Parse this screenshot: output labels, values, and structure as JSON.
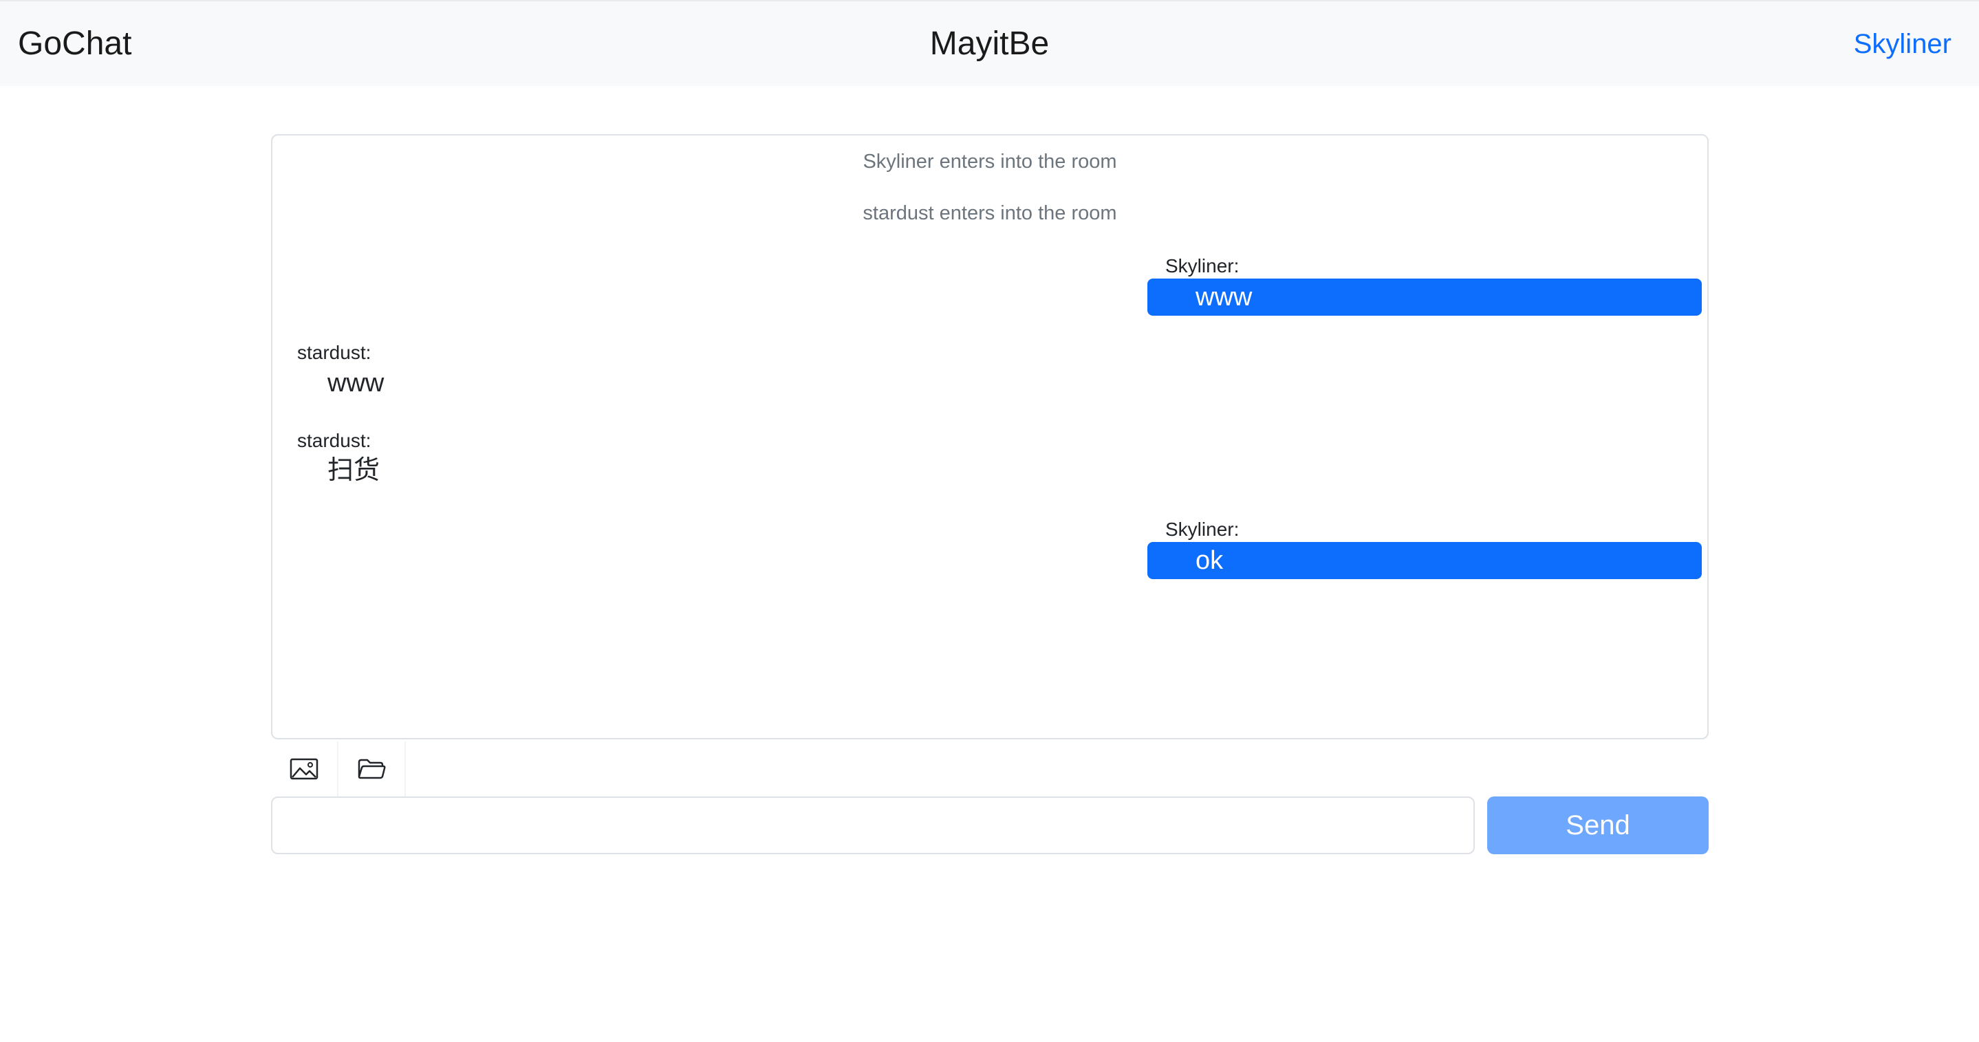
{
  "navbar": {
    "brand": "GoChat",
    "room_name": "MayitBe",
    "current_user": "Skyliner"
  },
  "messages": [
    {
      "type": "system",
      "text": "Skyliner enters into the room"
    },
    {
      "type": "system",
      "text": "stardust enters into the room"
    },
    {
      "type": "self",
      "sender": "Skyliner:",
      "text": "www"
    },
    {
      "type": "other",
      "sender": "stardust:",
      "text": "www"
    },
    {
      "type": "other",
      "sender": "stardust:",
      "text": "扫货"
    },
    {
      "type": "self",
      "sender": "Skyliner:",
      "text": "ok"
    }
  ],
  "toolbar": {
    "image_icon": "image-icon",
    "folder_icon": "folder-icon"
  },
  "composer": {
    "input_value": "",
    "placeholder": "",
    "send_label": "Send"
  },
  "colors": {
    "accent": "#0d6efd",
    "send_button": "#6ea8fe",
    "navbar_bg": "#f8f9fa"
  }
}
